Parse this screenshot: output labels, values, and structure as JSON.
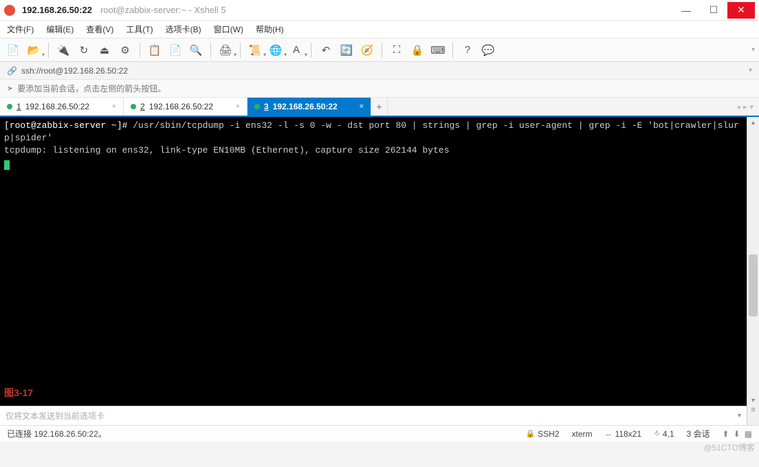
{
  "window": {
    "title": "192.168.26.50:22",
    "subtitle": "root@zabbix-server:~ - Xshell 5"
  },
  "menu": {
    "file": "文件(F)",
    "edit": "编辑(E)",
    "view": "查看(V)",
    "tools": "工具(T)",
    "tabs": "选项卡(B)",
    "window": "窗口(W)",
    "help": "帮助(H)"
  },
  "addressbar": {
    "url": "ssh://root@192.168.26.50:22"
  },
  "infobar": {
    "text": "要添加当前会话，点击左侧的箭头按钮。"
  },
  "tabs": [
    {
      "num": "1",
      "label": "192.168.26.50:22",
      "active": false
    },
    {
      "num": "2",
      "label": "192.168.26.50:22",
      "active": false
    },
    {
      "num": "3",
      "label": "192.168.26.50:22",
      "active": true
    }
  ],
  "terminal": {
    "prompt": "[root@zabbix-server ~]# ",
    "command": "/usr/sbin/tcpdump -i ens32 -l -s 0 -w - dst port 80 | strings | grep -i user-agent | grep -i -E 'bot|crawler|slurp|spider'",
    "output1": "tcpdump: listening on ens32, link-type EN10MB (Ethernet), capture size 262144 bytes",
    "figure_label": "图3-17"
  },
  "inputline": {
    "placeholder": "仅将文本发送到当前选项卡"
  },
  "statusbar": {
    "left": "已连接 192.168.26.50:22。",
    "ssh": "SSH2",
    "term": "xterm",
    "size": "118x21",
    "pos": "4,1",
    "sessions": "3 会话"
  },
  "watermark": "@51CTO博客"
}
